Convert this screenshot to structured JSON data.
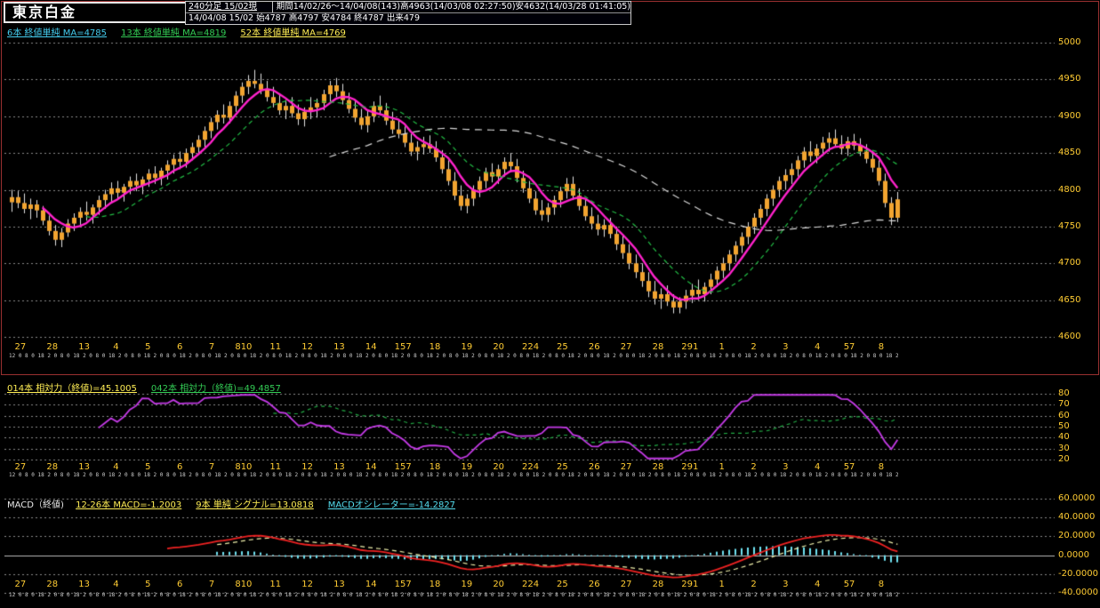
{
  "window": {
    "title": "東京白金"
  },
  "header": {
    "timeframe": "240分足 15/02現",
    "period_line": "期間14/02/26～14/04/08(143)高4963(14/03/08 02:27:50)安4632(14/03/28 01:41:05)",
    "quote_line": "14/04/08 15/02 始4787 高4797 安4784 終4787 出来479",
    "ma_legend": [
      {
        "label": "6本 終値単純 MA=4785",
        "color": "#44ccee"
      },
      {
        "label": "13本 終値単純 MA=4819",
        "color": "#33cc55"
      },
      {
        "label": "52本 終値単純 MA=4769",
        "color": "#ffee55"
      }
    ]
  },
  "rsi_header": [
    {
      "label": "014本 相対力（終値)=45.1005",
      "color": "#ffee55"
    },
    {
      "label": "042本 相対力（終値)=49.4857",
      "color": "#33cc55"
    }
  ],
  "macd_header": {
    "title": "MACD（終値)",
    "items": [
      {
        "label": "12-26本 MACD=-1.2003",
        "color": "#ffee55"
      },
      {
        "label": "9本 単純 シグナル=13.0818",
        "color": "#ffee55"
      },
      {
        "label": "MACDオシレーター=-14.2827",
        "color": "#55ddee"
      }
    ]
  },
  "chart_data": {
    "type": "candlestick",
    "title": "東京白金 240分足",
    "ylim": [
      4600,
      5000
    ],
    "y_ticks": [
      5000,
      4950,
      4900,
      4850,
      4800,
      4750,
      4700,
      4650,
      4600
    ],
    "x_labels": [
      "27",
      "28",
      "13",
      "4",
      "5",
      "6",
      "7",
      "810",
      "11",
      "12",
      "13",
      "14",
      "157",
      "18",
      "19",
      "20",
      "224",
      "25",
      "26",
      "27",
      "28",
      "291",
      "1",
      "2",
      "3",
      "4",
      "57",
      "8"
    ],
    "hour_row": "12 0 8 0 18 2 0 8 0 18 2 0 8 0 18 2 0 8 0 18 2 0 8 0 18 2 0 8 0 18 2 0 8 0 18 2 0 8 0 18 2 0 8 0 18 2 0 8 0 18 2 0 8 0 18 2 0 8 0 18 2 0 8 0 18 2 0 8 0 18 2 0 8 0 18 2 0 8 0 18 2 0 8 0 18 2 0 8 0 18 2 0 8 0 18 2 0 8 0 18 2 0 8 0 18 2 0 8 0 18 2 0 8 0 18 2 0 8 0 18 2 0 8 0 18 2 0 8 0 18 2 0 8 0 18 2 0 8 0 18",
    "candles": [
      [
        4783,
        4800,
        4770,
        4790
      ],
      [
        4790,
        4798,
        4775,
        4782
      ],
      [
        4782,
        4795,
        4768,
        4774
      ],
      [
        4774,
        4788,
        4760,
        4780
      ],
      [
        4780,
        4786,
        4762,
        4772
      ],
      [
        4772,
        4778,
        4752,
        4758
      ],
      [
        4758,
        4765,
        4738,
        4744
      ],
      [
        4744,
        4752,
        4724,
        4732
      ],
      [
        4732,
        4748,
        4722,
        4742
      ],
      [
        4742,
        4760,
        4736,
        4754
      ],
      [
        4754,
        4768,
        4744,
        4762
      ],
      [
        4762,
        4776,
        4752,
        4770
      ],
      [
        4770,
        4784,
        4758,
        4766
      ],
      [
        4766,
        4780,
        4754,
        4776
      ],
      [
        4776,
        4792,
        4766,
        4786
      ],
      [
        4786,
        4800,
        4774,
        4794
      ],
      [
        4794,
        4810,
        4782,
        4802
      ],
      [
        4802,
        4812,
        4788,
        4796
      ],
      [
        4796,
        4808,
        4784,
        4804
      ],
      [
        4804,
        4818,
        4794,
        4812
      ],
      [
        4812,
        4822,
        4798,
        4806
      ],
      [
        4806,
        4818,
        4794,
        4814
      ],
      [
        4814,
        4828,
        4804,
        4822
      ],
      [
        4822,
        4832,
        4808,
        4816
      ],
      [
        4816,
        4830,
        4806,
        4826
      ],
      [
        4826,
        4840,
        4814,
        4834
      ],
      [
        4834,
        4848,
        4822,
        4842
      ],
      [
        4842,
        4852,
        4828,
        4838
      ],
      [
        4838,
        4856,
        4830,
        4850
      ],
      [
        4850,
        4864,
        4840,
        4858
      ],
      [
        4858,
        4874,
        4848,
        4868
      ],
      [
        4868,
        4886,
        4858,
        4880
      ],
      [
        4880,
        4898,
        4870,
        4892
      ],
      [
        4892,
        4908,
        4882,
        4902
      ],
      [
        4902,
        4916,
        4890,
        4898
      ],
      [
        4898,
        4920,
        4890,
        4914
      ],
      [
        4914,
        4934,
        4906,
        4928
      ],
      [
        4928,
        4946,
        4918,
        4940
      ],
      [
        4940,
        4956,
        4930,
        4948
      ],
      [
        4948,
        4963,
        4938,
        4944
      ],
      [
        4944,
        4958,
        4930,
        4936
      ],
      [
        4936,
        4948,
        4920,
        4926
      ],
      [
        4926,
        4940,
        4912,
        4918
      ],
      [
        4918,
        4930,
        4902,
        4908
      ],
      [
        4908,
        4922,
        4896,
        4914
      ],
      [
        4914,
        4926,
        4898,
        4904
      ],
      [
        4904,
        4916,
        4888,
        4896
      ],
      [
        4896,
        4912,
        4886,
        4906
      ],
      [
        4906,
        4926,
        4896,
        4912
      ],
      [
        4912,
        4924,
        4898,
        4918
      ],
      [
        4918,
        4936,
        4908,
        4930
      ],
      [
        4930,
        4948,
        4920,
        4942
      ],
      [
        4942,
        4952,
        4926,
        4934
      ],
      [
        4934,
        4944,
        4916,
        4922
      ],
      [
        4922,
        4932,
        4904,
        4910
      ],
      [
        4910,
        4920,
        4892,
        4898
      ],
      [
        4898,
        4910,
        4882,
        4888
      ],
      [
        4888,
        4908,
        4878,
        4900
      ],
      [
        4900,
        4920,
        4892,
        4914
      ],
      [
        4914,
        4928,
        4902,
        4908
      ],
      [
        4908,
        4918,
        4888,
        4894
      ],
      [
        4894,
        4906,
        4876,
        4882
      ],
      [
        4882,
        4896,
        4870,
        4876
      ],
      [
        4876,
        4886,
        4858,
        4864
      ],
      [
        4864,
        4876,
        4846,
        4852
      ],
      [
        4852,
        4866,
        4840,
        4858
      ],
      [
        4858,
        4872,
        4848,
        4862
      ],
      [
        4862,
        4874,
        4850,
        4856
      ],
      [
        4856,
        4866,
        4838,
        4844
      ],
      [
        4844,
        4854,
        4822,
        4828
      ],
      [
        4828,
        4840,
        4806,
        4812
      ],
      [
        4812,
        4824,
        4786,
        4792
      ],
      [
        4792,
        4806,
        4772,
        4778
      ],
      [
        4778,
        4794,
        4768,
        4788
      ],
      [
        4788,
        4806,
        4778,
        4800
      ],
      [
        4800,
        4818,
        4790,
        4812
      ],
      [
        4812,
        4830,
        4802,
        4824
      ],
      [
        4824,
        4836,
        4810,
        4818
      ],
      [
        4818,
        4834,
        4808,
        4828
      ],
      [
        4828,
        4844,
        4818,
        4838
      ],
      [
        4838,
        4850,
        4824,
        4832
      ],
      [
        4832,
        4842,
        4810,
        4816
      ],
      [
        4816,
        4826,
        4796,
        4802
      ],
      [
        4802,
        4812,
        4782,
        4788
      ],
      [
        4788,
        4798,
        4766,
        4772
      ],
      [
        4772,
        4786,
        4758,
        4766
      ],
      [
        4766,
        4782,
        4756,
        4776
      ],
      [
        4776,
        4792,
        4766,
        4786
      ],
      [
        4786,
        4804,
        4776,
        4798
      ],
      [
        4798,
        4816,
        4788,
        4808
      ],
      [
        4808,
        4818,
        4786,
        4792
      ],
      [
        4792,
        4802,
        4772,
        4778
      ],
      [
        4778,
        4788,
        4758,
        4764
      ],
      [
        4764,
        4776,
        4746,
        4754
      ],
      [
        4754,
        4766,
        4738,
        4746
      ],
      [
        4746,
        4760,
        4736,
        4752
      ],
      [
        4752,
        4762,
        4734,
        4740
      ],
      [
        4740,
        4750,
        4718,
        4726
      ],
      [
        4726,
        4738,
        4706,
        4714
      ],
      [
        4714,
        4726,
        4692,
        4700
      ],
      [
        4700,
        4712,
        4680,
        4688
      ],
      [
        4688,
        4700,
        4668,
        4676
      ],
      [
        4676,
        4688,
        4654,
        4662
      ],
      [
        4662,
        4676,
        4644,
        4652
      ],
      [
        4652,
        4666,
        4638,
        4658
      ],
      [
        4658,
        4670,
        4642,
        4648
      ],
      [
        4648,
        4658,
        4632,
        4640
      ],
      [
        4640,
        4654,
        4632,
        4648
      ],
      [
        4648,
        4664,
        4638,
        4656
      ],
      [
        4656,
        4672,
        4646,
        4664
      ],
      [
        4664,
        4678,
        4650,
        4658
      ],
      [
        4658,
        4674,
        4648,
        4668
      ],
      [
        4668,
        4686,
        4658,
        4678
      ],
      [
        4678,
        4696,
        4668,
        4690
      ],
      [
        4690,
        4708,
        4680,
        4700
      ],
      [
        4700,
        4718,
        4690,
        4712
      ],
      [
        4712,
        4730,
        4702,
        4724
      ],
      [
        4724,
        4742,
        4714,
        4736
      ],
      [
        4736,
        4756,
        4726,
        4750
      ],
      [
        4750,
        4768,
        4740,
        4762
      ],
      [
        4762,
        4780,
        4752,
        4774
      ],
      [
        4774,
        4794,
        4764,
        4788
      ],
      [
        4788,
        4806,
        4778,
        4800
      ],
      [
        4800,
        4818,
        4790,
        4812
      ],
      [
        4812,
        4828,
        4800,
        4820
      ],
      [
        4820,
        4836,
        4808,
        4828
      ],
      [
        4828,
        4846,
        4818,
        4840
      ],
      [
        4840,
        4858,
        4830,
        4852
      ],
      [
        4852,
        4866,
        4838,
        4846
      ],
      [
        4846,
        4862,
        4836,
        4856
      ],
      [
        4856,
        4872,
        4846,
        4864
      ],
      [
        4864,
        4878,
        4852,
        4870
      ],
      [
        4870,
        4882,
        4858,
        4862
      ],
      [
        4862,
        4874,
        4848,
        4856
      ],
      [
        4856,
        4872,
        4846,
        4866
      ],
      [
        4866,
        4876,
        4854,
        4860
      ],
      [
        4860,
        4870,
        4846,
        4852
      ],
      [
        4852,
        4862,
        4836,
        4842
      ],
      [
        4842,
        4852,
        4824,
        4830
      ],
      [
        4830,
        4840,
        4806,
        4812
      ],
      [
        4812,
        4822,
        4776,
        4782
      ],
      [
        4782,
        4790,
        4752,
        4762
      ],
      [
        4762,
        4797,
        4756,
        4787
      ]
    ],
    "overlays": [
      {
        "name": "MA6",
        "period": 6,
        "type": "sma",
        "color": "#ff22cc",
        "style": "solid"
      },
      {
        "name": "MA13",
        "period": 13,
        "type": "sma",
        "color": "#22bb44",
        "style": "dashed"
      },
      {
        "name": "MA52",
        "period": 52,
        "type": "sma",
        "color": "#d8d8d8",
        "style": "dashed"
      }
    ],
    "rsi_panel": {
      "type": "line",
      "ylim": [
        20,
        80
      ],
      "y_ticks": [
        80,
        70,
        60,
        50,
        40,
        30,
        20
      ],
      "series": [
        {
          "name": "相対力14",
          "period": 14,
          "color": "#c43ae6",
          "style": "solid"
        },
        {
          "name": "相対力42",
          "period": 42,
          "color": "#22aa44",
          "style": "dashed"
        }
      ]
    },
    "macd_panel": {
      "type": "line+histogram",
      "ylim": [
        -40,
        60
      ],
      "y_tick_values": [
        60,
        40,
        20,
        0,
        -20,
        -40
      ],
      "y_tick_labels": [
        "60.0000",
        "40.0000",
        "20.0000",
        "0.0000",
        "-20.0000",
        "-40.0000"
      ],
      "macd_fast": 12,
      "macd_slow": 26,
      "signal_period": 9,
      "colors": {
        "macd": "#ee2222",
        "signal": "#eeeeaa",
        "histogram": "#6fe2f2"
      }
    }
  }
}
